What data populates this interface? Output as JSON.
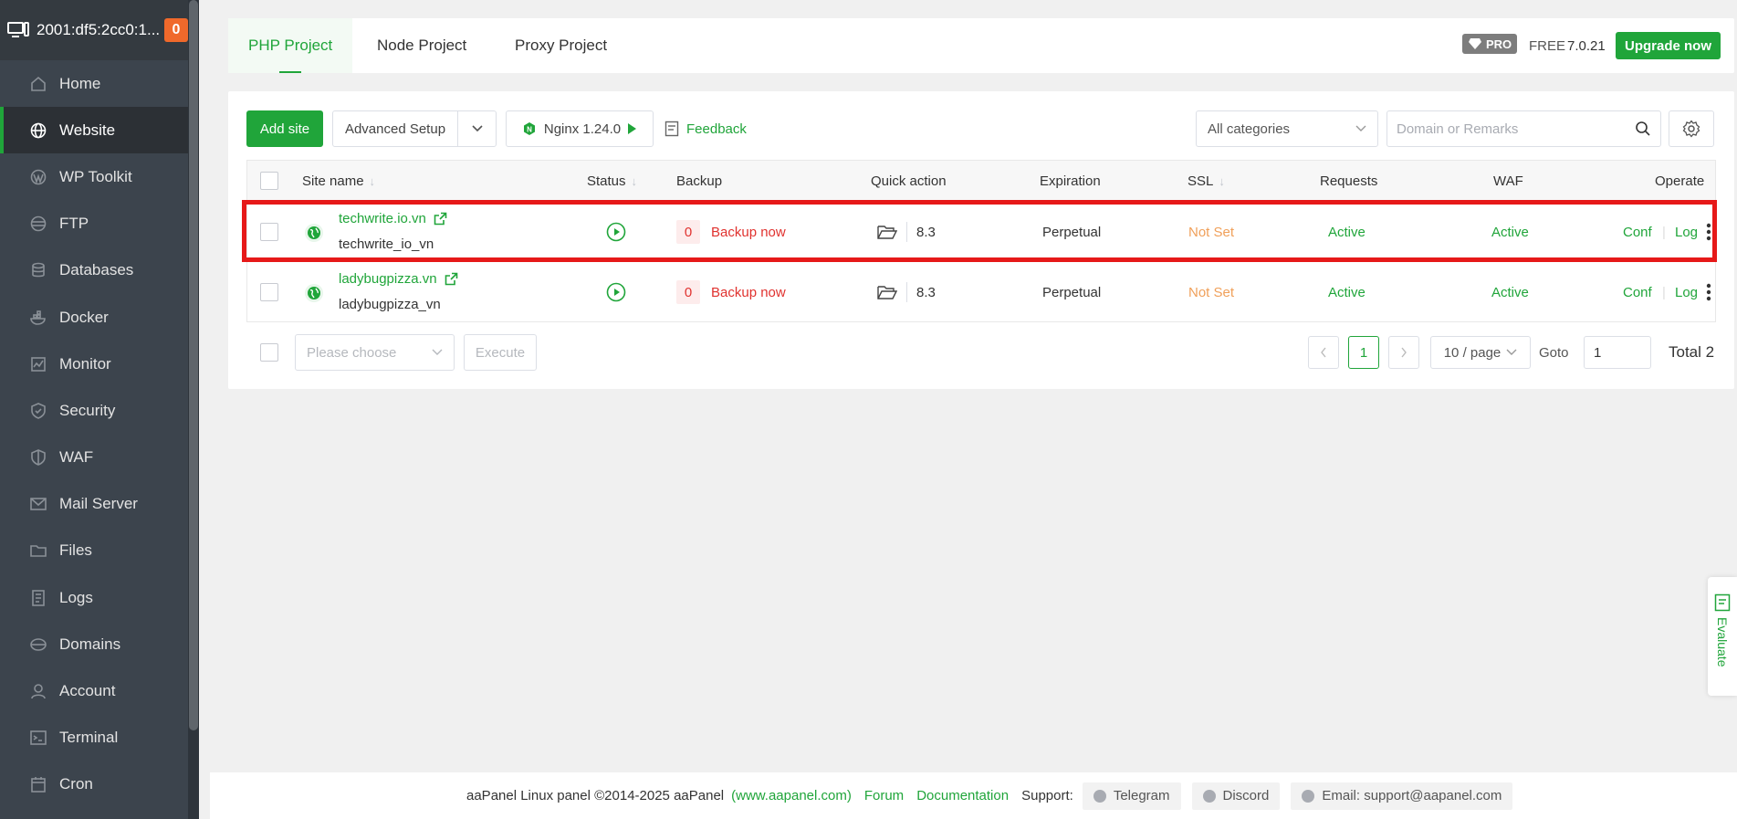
{
  "server": {
    "ip": "2001:df5:2cc0:1...",
    "badge": "0"
  },
  "sidebar": {
    "items": [
      {
        "label": "Home",
        "icon": "home-icon"
      },
      {
        "label": "Website",
        "icon": "globe-icon"
      },
      {
        "label": "WP Toolkit",
        "icon": "wordpress-icon"
      },
      {
        "label": "FTP",
        "icon": "ftp-icon"
      },
      {
        "label": "Databases",
        "icon": "database-icon"
      },
      {
        "label": "Docker",
        "icon": "docker-icon"
      },
      {
        "label": "Monitor",
        "icon": "monitor-icon"
      },
      {
        "label": "Security",
        "icon": "shield-icon"
      },
      {
        "label": "WAF",
        "icon": "waf-icon"
      },
      {
        "label": "Mail Server",
        "icon": "mail-icon"
      },
      {
        "label": "Files",
        "icon": "folder-icon"
      },
      {
        "label": "Logs",
        "icon": "logs-icon"
      },
      {
        "label": "Domains",
        "icon": "domains-icon"
      },
      {
        "label": "Account",
        "icon": "user-icon"
      },
      {
        "label": "Terminal",
        "icon": "terminal-icon"
      },
      {
        "label": "Cron",
        "icon": "calendar-icon"
      }
    ]
  },
  "header": {
    "tabs": [
      "PHP Project",
      "Node Project",
      "Proxy Project"
    ],
    "pro": "PRO",
    "free": "FREE",
    "version": "7.0.21",
    "upgrade": "Upgrade now"
  },
  "toolbar": {
    "add_site": "Add site",
    "advanced_setup": "Advanced Setup",
    "nginx": "Nginx 1.24.0",
    "feedback": "Feedback",
    "category": "All categories",
    "search_placeholder": "Domain or Remarks"
  },
  "table": {
    "columns": [
      "Site name",
      "Status",
      "Backup",
      "Quick action",
      "Expiration",
      "SSL",
      "Requests",
      "WAF",
      "Operate"
    ],
    "rows": [
      {
        "name": "techwrite.io.vn",
        "remark": "techwrite_io_vn",
        "backup_count": "0",
        "backup": "Backup now",
        "php": "8.3",
        "expiration": "Perpetual",
        "ssl": "Not Set",
        "requests": "Active",
        "waf": "Active",
        "conf": "Conf",
        "log": "Log"
      },
      {
        "name": "ladybugpizza.vn",
        "remark": "ladybugpizza_vn",
        "backup_count": "0",
        "backup": "Backup now",
        "php": "8.3",
        "expiration": "Perpetual",
        "ssl": "Not Set",
        "requests": "Active",
        "waf": "Active",
        "conf": "Conf",
        "log": "Log"
      }
    ]
  },
  "batch": {
    "placeholder": "Please choose",
    "execute": "Execute"
  },
  "pagination": {
    "page": "1",
    "per_page": "10 / page",
    "goto": "Goto",
    "goto_value": "1",
    "total": "Total 2"
  },
  "evaluate": "Evaluate",
  "footer": {
    "copyright": "aaPanel Linux panel ©2014-2025 aaPanel",
    "site": "(www.aapanel.com)",
    "forum": "Forum",
    "documentation": "Documentation",
    "support": "Support:",
    "telegram": "Telegram",
    "discord": "Discord",
    "email": "Email: support@aapanel.com"
  },
  "colors": {
    "accent": "#20a53a",
    "sidebar": "#3c444d",
    "danger": "#e0322f",
    "highlight": "#e61919"
  }
}
